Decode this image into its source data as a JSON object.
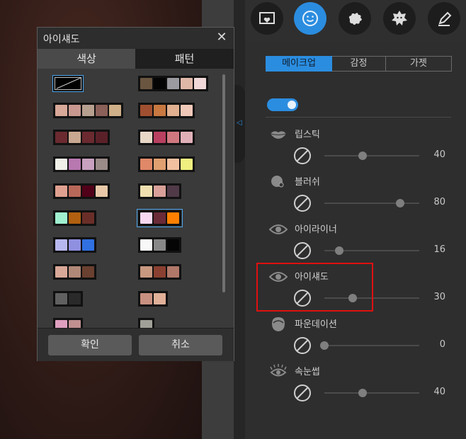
{
  "toolbar": {
    "icons": [
      "frame-heart-icon",
      "smiley-icon",
      "splash-icon",
      "badge-icon",
      "pencil-icon"
    ],
    "active": "smiley-icon"
  },
  "tabs": [
    {
      "label": "메이크업",
      "active": true
    },
    {
      "label": "감정",
      "active": false
    },
    {
      "label": "가젯",
      "active": false
    }
  ],
  "toggle": {
    "on": true
  },
  "rows": [
    {
      "icon": "lips-icon",
      "label": "립스틱",
      "value": "40",
      "level": 0.4
    },
    {
      "icon": "blush-icon",
      "label": "블러쉬",
      "value": "80",
      "level": 0.8
    },
    {
      "icon": "eye-icon",
      "label": "아이라이너",
      "value": "16",
      "level": 0.16
    },
    {
      "icon": "eye-icon",
      "label": "아이섀도",
      "value": "30",
      "level": 0.3
    },
    {
      "icon": "face-icon",
      "label": "파운데이션",
      "value": "0",
      "level": 0.0
    },
    {
      "icon": "lashes-icon",
      "label": "속눈썹",
      "value": "40",
      "level": 0.4
    }
  ],
  "dialog": {
    "title": "아이섀도",
    "tab_color": "색상",
    "tab_pattern": "패턴",
    "ok": "확인",
    "cancel": "취소"
  },
  "palettes": [
    {
      "col": 0,
      "colors": []
    },
    {
      "col": 1,
      "colors": [
        "#6a5540",
        "#050505",
        "#9a9aa0",
        "#e0b8a8",
        "#f0d8d8"
      ]
    },
    {
      "col": 0,
      "colors": [
        "#d8a898",
        "#c89890",
        "#b8a090",
        "#8a6058",
        "#d0b088"
      ]
    },
    {
      "col": 1,
      "colors": [
        "#a05030",
        "#c87840",
        "#e0b090",
        "#f0c8b8"
      ]
    },
    {
      "col": 0,
      "colors": [
        "#6a2a30",
        "#c8a890",
        "#6a2a30",
        "#5a2028"
      ]
    },
    {
      "col": 1,
      "colors": [
        "#e8d8c8",
        "#b84060",
        "#d07880",
        "#e0b0b8"
      ]
    },
    {
      "col": 0,
      "colors": [
        "#f0f0e8",
        "#b878b0",
        "#c8a0c0",
        "#9a8a88"
      ]
    },
    {
      "col": 1,
      "colors": [
        "#e08868",
        "#e0a070",
        "#f0c0a0",
        "#f0f080"
      ]
    },
    {
      "col": 0,
      "colors": [
        "#e0a090",
        "#b86858",
        "#500018",
        "#e8c8a8"
      ]
    },
    {
      "col": 1,
      "colors": [
        "#f0e0b0",
        "#d8a098",
        "#503a48"
      ]
    },
    {
      "col": 0,
      "colors": [
        "#a0f0d0",
        "#b06010",
        "#6a2e28"
      ]
    },
    {
      "col": 1,
      "colors": [
        "#f8d8f0",
        "#6a2a38",
        "#ff8000"
      ],
      "selected": true
    },
    {
      "col": 0,
      "colors": [
        "#b8b8f0",
        "#9090e0",
        "#3070e0"
      ]
    },
    {
      "col": 1,
      "colors": [
        "#f8f8f8",
        "#888888",
        "#050505"
      ]
    },
    {
      "col": 0,
      "colors": [
        "#d8a898",
        "#b08878",
        "#6a4030"
      ]
    },
    {
      "col": 1,
      "colors": [
        "#c89880",
        "#8a4030",
        "#b07868"
      ]
    },
    {
      "col": 0,
      "colors": [
        "#606060",
        "#2a2a2a"
      ]
    },
    {
      "col": 1,
      "colors": [
        "#c89080",
        "#e0b098"
      ]
    },
    {
      "col": 0,
      "colors": [
        "#e0a0c0",
        "#c09090"
      ]
    },
    {
      "col": 1,
      "colors": [
        "#a0a098"
      ]
    }
  ]
}
